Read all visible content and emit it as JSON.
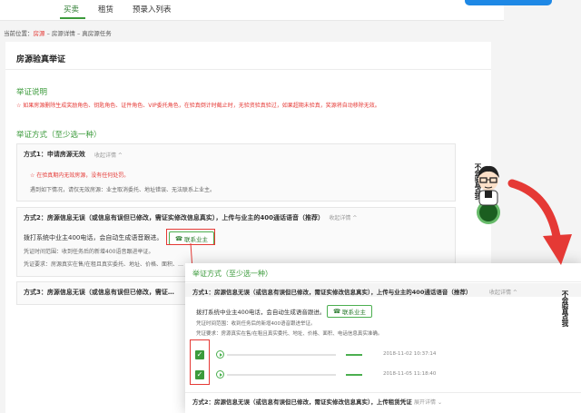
{
  "nav": {
    "items": [
      "买卖",
      "租赁",
      "预录入列表"
    ],
    "active_index": 0
  },
  "breadcrumb": {
    "prefix": "当前位置：",
    "home": "房源",
    "rest": " – 房源详情 – 真房源任务"
  },
  "page": {
    "title": "房源验真举证"
  },
  "instructions": {
    "title": "举证说明",
    "warning": "☆ 如果房源删除生成奖励角色、钥匙角色、证件角色、VIP委托角色，在验真倒计时截止时，无验资验真验过，如果超期未验真，奖源将自动移除无效。"
  },
  "methods": {
    "title": "举证方式（至少选一种）",
    "m1": {
      "title": "方式1：申请房源无效",
      "toggle": "收起详情 ^",
      "line1": "☆ 在验真期内无效房源，没有任何处罚。",
      "line2": "遇到如下情况，请仅无效房源：业主取消委托、地址错误、无法联系上业主。"
    },
    "m2": {
      "title": "方式2：房源信息无误（或信息有误但已修改，需证实修改信息真实），上传与业主的400通话语音（推荐）",
      "toggle": "收起详情 ^",
      "dial": "拨打系统中业主400电话，会自动生成语音跟进。",
      "phone_button": "联系业主",
      "range": "凭证时间范围：收到任务后的新增400语音跟进举证。",
      "requirement": "凭证要求：房源真实在售/在租且真实委托、地址、价格、面积、…"
    },
    "m3": {
      "title": "方式3：房源信息无误（或信息有误但已修改，需证…"
    }
  },
  "zoom": {
    "methods_title": "举证方式（至少选一种）",
    "m1": {
      "title": "方式1：房源信息无误（或信息有误但已修改，需证实修改信息真实），上传与业主的400通话语音（推荐）",
      "toggle": "收起详情 ^",
      "dial": "拨打系统中业主400电话，会自动生成语音跟进。",
      "phone_button": "联系业主",
      "range": "凭证时间范围：收到任务后的新增400语音跟进举证。",
      "requirement": "凭证要求：房源真实在售/在租且真实委托、地址、价格、面积、电话信息真实准确。"
    },
    "records": [
      {
        "timestamp": "2018-11-02 10:37:14",
        "checked": true
      },
      {
        "timestamp": "2018-11-05 11:18:40",
        "checked": true
      }
    ],
    "m2": {
      "title": "方式2：房源信息无误（或信息有误但已修改，需证实修改信息真实），上传租赁凭证",
      "toggle": "展开详情 ⌄"
    }
  },
  "stickers": {
    "top": "不会验真点我",
    "bottom": "不会验真点我"
  },
  "colors": {
    "accent": "#3c9b3c",
    "alert": "#e53935",
    "link": "#1e88e5"
  }
}
